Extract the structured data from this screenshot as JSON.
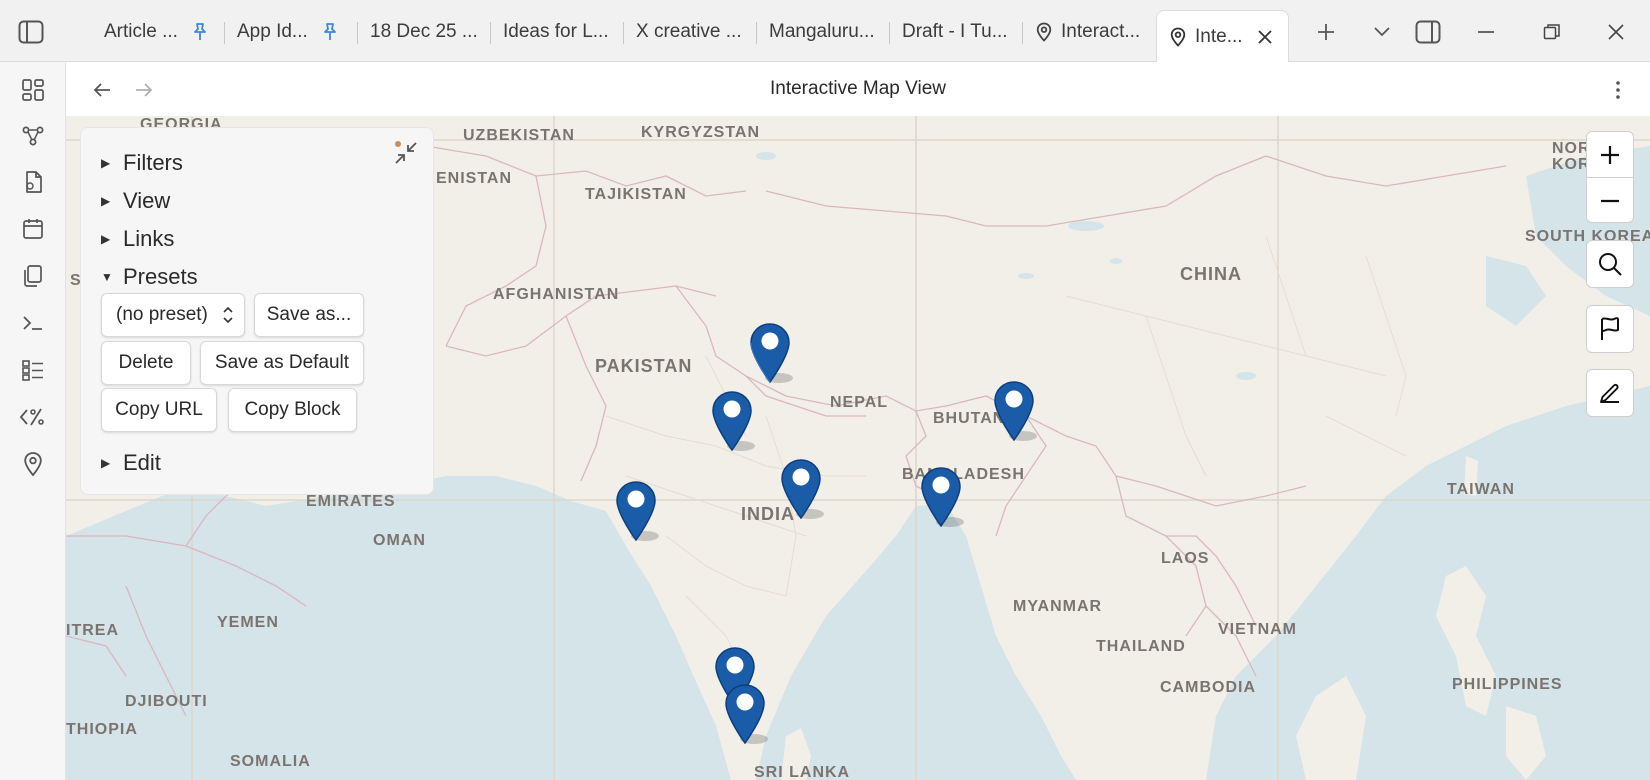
{
  "tabs": [
    {
      "label": "Article ...",
      "pinned": true
    },
    {
      "label": "App Id...",
      "pinned": true
    },
    {
      "label": "18 Dec 25 ...",
      "pinned": false
    },
    {
      "label": "Ideas for L...",
      "pinned": false
    },
    {
      "label": "X creative ...",
      "pinned": false
    },
    {
      "label": "Mangaluru...",
      "pinned": false
    },
    {
      "label": "Draft - I Tu...",
      "pinned": false
    },
    {
      "label": "Interact...",
      "pinned": false,
      "icon": "map-pin-icon"
    },
    {
      "label": "Inte...",
      "pinned": false,
      "icon": "map-pin-icon",
      "active": true
    }
  ],
  "view": {
    "title": "Interactive Map View"
  },
  "panel": {
    "sections": {
      "filters": "Filters",
      "view": "View",
      "links": "Links",
      "presets": "Presets",
      "edit": "Edit"
    },
    "presets": {
      "selected": "(no preset)",
      "save_as": "Save as...",
      "delete": "Delete",
      "save_default": "Save as Default",
      "copy_url": "Copy URL",
      "copy_block": "Copy Block"
    }
  },
  "map_labels": {
    "georgia": "GEORGIA",
    "uzbekistan": "UZBEKISTAN",
    "kyrgyzstan": "KYRGYZSTAN",
    "tajikistan": "TAJIKISTAN",
    "enistan": "ENISTAN",
    "afghanistan": "AFGHANISTAN",
    "pakistan": "PAKISTAN",
    "nepal": "NEPAL",
    "bhutan": "BHUTAN",
    "bangladesh": "BANGLADESH",
    "india": "INDIA",
    "china": "CHINA",
    "emirates": "EMIRATES",
    "oman": "OMAN",
    "yemen": "YEMEN",
    "itrea": "ITREA",
    "djibouti": "DJIBOUTI",
    "thiopia": "THIOPIA",
    "somalia": "SOMALIA",
    "srilanka": "SRI LANKA",
    "myanmar": "MYANMAR",
    "laos": "LAOS",
    "thailand": "THAILAND",
    "vietnam": "VIETNAM",
    "cambodia": "CAMBODIA",
    "philippines": "PHILIPPINES",
    "taiwan": "TAIWAN",
    "southkorea": "SOUTH KOREA",
    "northkorea_1": "NOR",
    "northkorea_2": "KOR",
    "s": "S"
  },
  "colors": {
    "marker": "#1a5ca8",
    "marker_dark": "#0d3f7e",
    "pin_accent": "#3a8ad8",
    "water": "#d4e4e8",
    "land": "#f2efe9"
  }
}
